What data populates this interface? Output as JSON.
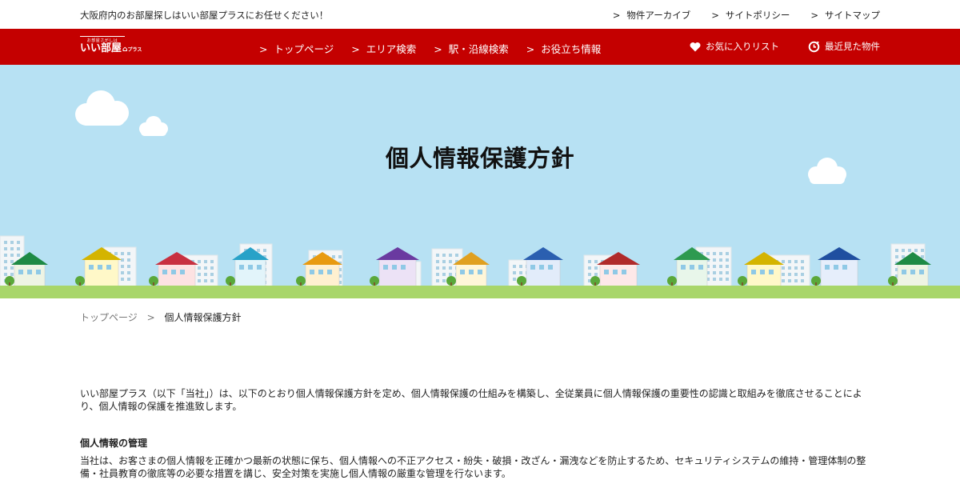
{
  "topbar": {
    "tagline": "大阪府内のお部屋探しはいい部屋プラスにお任せください！",
    "links": [
      "物件アーカイブ",
      "サイトポリシー",
      "サイトマップ"
    ]
  },
  "logo": {
    "small": "お部屋さがしは",
    "big": "いい部屋",
    "plus": "プラス"
  },
  "nav": {
    "items": [
      "トップページ",
      "エリア検索",
      "駅・沿線検索",
      "お役立ち情報"
    ],
    "favorites": "お気に入りリスト",
    "recent": "最近見た物件"
  },
  "hero": {
    "title": "個人情報保護方針"
  },
  "breadcrumb": {
    "home": "トップページ",
    "sep": ">",
    "current": "個人情報保護方針"
  },
  "content": {
    "intro": "いい部屋プラス（以下「当社」）は、以下のとおり個人情報保護方針を定め、個人情報保護の仕組みを構築し、全従業員に個人情報保護の重要性の認識と取組みを徹底させることにより、個人情報の保護を推進致します。",
    "section1_title": "個人情報の管理",
    "section1_body": "当社は、お客さまの個人情報を正確かつ最新の状態に保ち、個人情報への不正アクセス・紛失・破損・改ざん・漏洩などを防止するため、セキュリティシステムの維持・管理体制の整備・社員教育の徹底等の必要な措置を講じ、安全対策を実施し個人情報の厳重な管理を行ないます。"
  },
  "colors": {
    "brand": "#c40000",
    "sky": "#b7e1f3",
    "grass": "#a8d66a"
  }
}
